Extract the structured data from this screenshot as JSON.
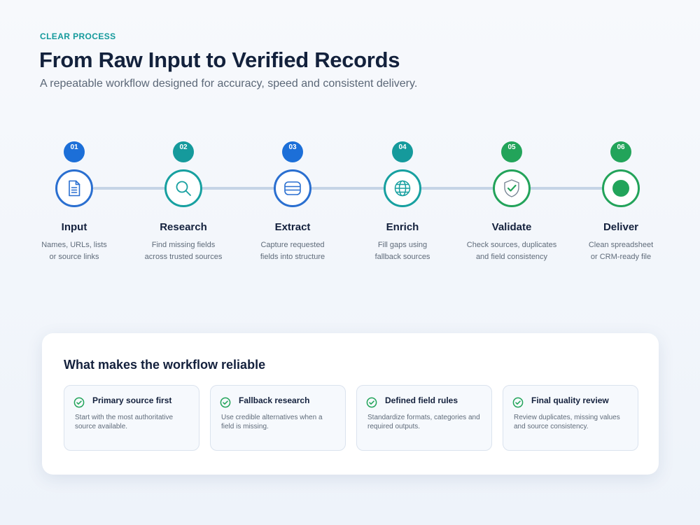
{
  "header": {
    "eyebrow": "CLEAR PROCESS",
    "title": "From Raw Input to Verified Records",
    "subtitle": "A repeatable workflow designed for accuracy, speed and consistent delivery."
  },
  "colors": {
    "blue": "#1c6fd8",
    "teal": "#159a9c",
    "green": "#22a45a",
    "connector": "#c5d4e6"
  },
  "steps": [
    {
      "number": "01",
      "name": "Input",
      "icon": "document-icon",
      "color": "blue",
      "desc": [
        "Names, URLs, lists",
        "or source links"
      ]
    },
    {
      "number": "02",
      "name": "Research",
      "icon": "search-icon",
      "color": "teal",
      "desc": [
        "Find missing fields",
        "across trusted sources"
      ]
    },
    {
      "number": "03",
      "name": "Extract",
      "icon": "database-icon",
      "color": "blue",
      "desc": [
        "Capture requested",
        "fields into structure"
      ]
    },
    {
      "number": "04",
      "name": "Enrich",
      "icon": "globe-icon",
      "color": "teal",
      "desc": [
        "Fill gaps using",
        "fallback sources"
      ]
    },
    {
      "number": "05",
      "name": "Validate",
      "icon": "shield-check-icon",
      "color": "green",
      "desc": [
        "Check sources, duplicates",
        "and field consistency"
      ]
    },
    {
      "number": "06",
      "name": "Deliver",
      "icon": "target-dot-icon",
      "color": "green",
      "desc": [
        "Clean spreadsheet",
        "or CRM-ready file"
      ]
    }
  ],
  "reliability": {
    "title": "What makes the workflow reliable",
    "items": [
      {
        "title": "Primary source first",
        "desc": "Start with the most authoritative source available.",
        "icon": "check-circle-icon"
      },
      {
        "title": "Fallback research",
        "desc": "Use credible alternatives when a field is missing.",
        "icon": "check-circle-icon"
      },
      {
        "title": "Defined field rules",
        "desc": "Standardize formats, categories and required outputs.",
        "icon": "check-circle-icon"
      },
      {
        "title": "Final quality review",
        "desc": "Review duplicates, missing values and source consistency.",
        "icon": "check-circle-icon"
      }
    ]
  }
}
